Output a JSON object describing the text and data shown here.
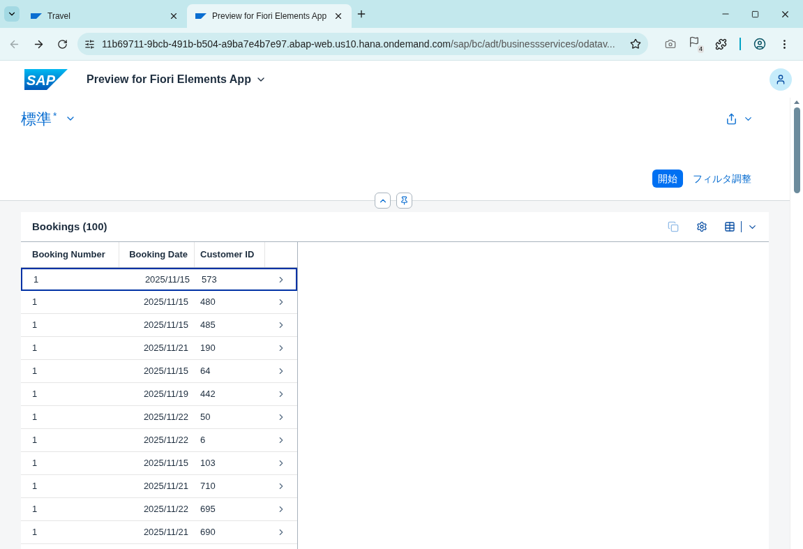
{
  "browser": {
    "tabs": [
      {
        "title": "Travel",
        "selected": false
      },
      {
        "title": "Preview for Fiori Elements App",
        "selected": true
      }
    ],
    "url": {
      "host": "11b69711-9bcb-491b-b504-a9ba7e4b7e97.abap-web.us10.hana.ondemand.com",
      "path": "/sap/bc/adt/businessservices/odatav..."
    },
    "extension_badge": "4"
  },
  "shell": {
    "logo": "SAP",
    "app_title": "Preview for Fiori Elements App"
  },
  "variant": {
    "name": "標準",
    "modified_mark": "*"
  },
  "filter_bar": {
    "go_button": "開始",
    "adapt_button": "フィルタ調整"
  },
  "table": {
    "title": "Bookings (100)",
    "columns": [
      "Booking Number",
      "Booking Date",
      "Customer ID"
    ],
    "rows": [
      {
        "cells": [
          "1",
          "2025/11/15",
          "573"
        ],
        "focused": true
      },
      {
        "cells": [
          "1",
          "2025/11/15",
          "480"
        ],
        "focused": false
      },
      {
        "cells": [
          "1",
          "2025/11/15",
          "485"
        ],
        "focused": false
      },
      {
        "cells": [
          "1",
          "2025/11/21",
          "190"
        ],
        "focused": false
      },
      {
        "cells": [
          "1",
          "2025/11/15",
          "64"
        ],
        "focused": false
      },
      {
        "cells": [
          "1",
          "2025/11/19",
          "442"
        ],
        "focused": false
      },
      {
        "cells": [
          "1",
          "2025/11/22",
          "50"
        ],
        "focused": false
      },
      {
        "cells": [
          "1",
          "2025/11/22",
          "6"
        ],
        "focused": false
      },
      {
        "cells": [
          "1",
          "2025/11/15",
          "103"
        ],
        "focused": false
      },
      {
        "cells": [
          "1",
          "2025/11/21",
          "710"
        ],
        "focused": false
      },
      {
        "cells": [
          "1",
          "2025/11/22",
          "695"
        ],
        "focused": false
      },
      {
        "cells": [
          "1",
          "2025/11/21",
          "690"
        ],
        "focused": false
      }
    ]
  }
}
